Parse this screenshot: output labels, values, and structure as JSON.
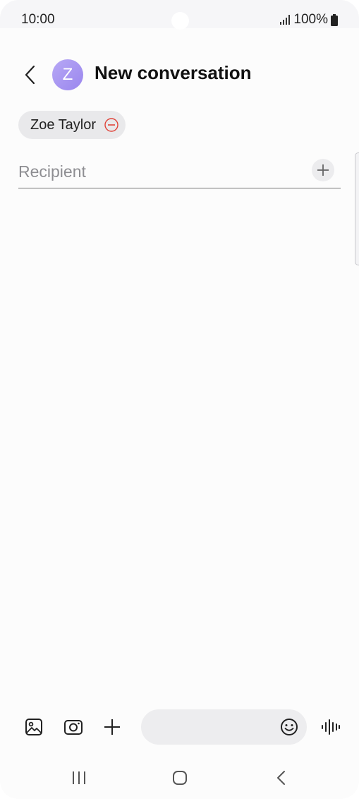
{
  "status_bar": {
    "time": "10:00",
    "battery": "100%",
    "icons": [
      "signal-icon",
      "battery-icon"
    ]
  },
  "header": {
    "back_icon": "chevron-left-icon",
    "avatar_letter": "Z",
    "title": "New conversation"
  },
  "recipients": {
    "chips": [
      {
        "label": "Zoe Taylor",
        "remove_icon": "minus-circle-icon"
      }
    ],
    "input": {
      "value": "",
      "placeholder": "Recipient",
      "add_icon": "plus-icon"
    }
  },
  "composer": {
    "tools": [
      "gallery-icon",
      "camera-icon",
      "plus-icon"
    ],
    "message_value": "",
    "emoji_icon": "emoji-icon",
    "voice_icon": "voice-waveform-icon"
  },
  "navigation": {
    "buttons": [
      "recent-apps-icon",
      "home-icon",
      "back-icon"
    ]
  },
  "colors": {
    "avatar": "#a997f2",
    "chip_background": "#e9e9eb",
    "remove_accent": "#e0443a",
    "background": "#fcfcfc"
  }
}
